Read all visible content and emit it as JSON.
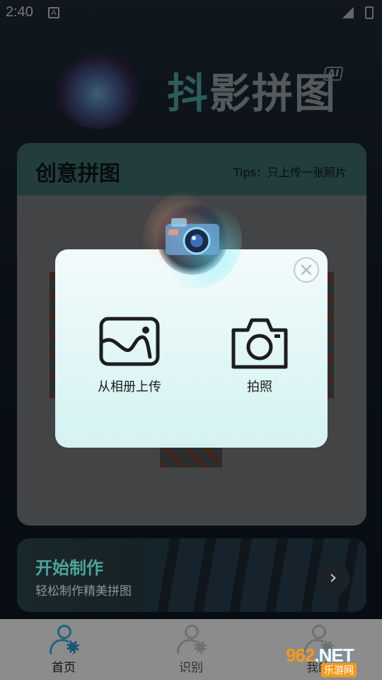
{
  "status_bar": {
    "time": "2:40",
    "notification_glyph": "A"
  },
  "header": {
    "brand_first_char": "抖",
    "brand_rest": "影拼图",
    "ai_badge": "AI"
  },
  "creative_card": {
    "title": "创意拼图",
    "tips": "Tips：只上传一张照片"
  },
  "start_banner": {
    "title": "开始制作",
    "subtitle": "轻松制作精美拼图",
    "arrow_glyph": "›"
  },
  "tabbar": {
    "tabs": [
      {
        "label": "首页",
        "active": true
      },
      {
        "label": "识别",
        "active": false
      },
      {
        "label": "我的",
        "active": false
      }
    ]
  },
  "upload_dialog": {
    "options": [
      {
        "label": "从相册上传",
        "icon": "gallery-icon"
      },
      {
        "label": "拍照",
        "icon": "camera-icon"
      }
    ],
    "close_icon": "close-icon"
  },
  "watermark": {
    "top_text": "962",
    "net": ".NET",
    "bottom_text": "乐游网"
  },
  "colors": {
    "accent": "#3eb6e0",
    "brand_teal": "#53a8a2",
    "dialog_bg": "#dff6f5"
  }
}
